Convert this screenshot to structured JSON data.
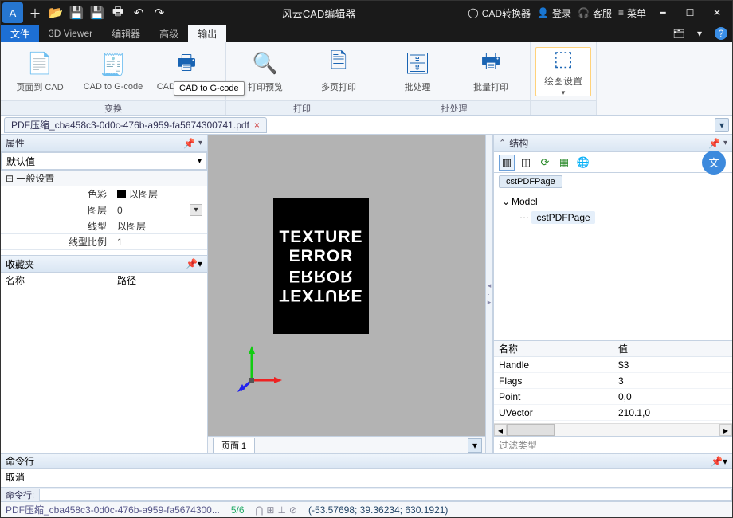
{
  "app": {
    "title": "风云CAD编辑器"
  },
  "titlebar_right": {
    "converter": "CAD转换器",
    "login": "登录",
    "service": "客服",
    "menu": "菜单"
  },
  "menutabs": {
    "file": "文件",
    "viewer": "3D Viewer",
    "editor": "编辑器",
    "advanced": "高级",
    "output": "输出"
  },
  "ribbon": {
    "convert_group": "变换",
    "print_group": "打印",
    "batch_group": "批处理",
    "page_to_cad": "页面到 CAD",
    "cad_to_gcode": "CAD to G-code",
    "cad_to_gcode_sub": "CAD to G-code",
    "print_preview": "打印预览",
    "multi_print": "多页打印",
    "batch": "批处理",
    "batch_print": "批量打印",
    "draw_settings": "绘图设置"
  },
  "tooltip": "CAD to G-code",
  "doctab": "PDF压缩_cba458c3-0d0c-476b-a959-fa5674300741.pdf",
  "panels": {
    "properties": "属性",
    "default": "默认值",
    "general": "一般设置",
    "color": "色彩",
    "color_val": "以图层",
    "layer": "图层",
    "layer_val": "0",
    "linetype": "线型",
    "linetype_val": "以图层",
    "scale": "线型比例",
    "scale_val": "1",
    "favorites": "收藏夹",
    "fav_name": "名称",
    "fav_path": "路径"
  },
  "canvas": {
    "texture": "TEXTURE",
    "error": "ERROR",
    "pagetab": "页面 1"
  },
  "structure": {
    "title": "结构",
    "crumb": "cstPDFPage",
    "model": "Model",
    "leaf": "cstPDFPage",
    "name_col": "名称",
    "value_col": "值",
    "rows": [
      {
        "n": "Handle",
        "v": "$3"
      },
      {
        "n": "Flags",
        "v": "3"
      },
      {
        "n": "Point",
        "v": "0,0"
      },
      {
        "n": "UVector",
        "v": "210.1,0"
      }
    ],
    "filter": "过滤类型"
  },
  "cmd": {
    "title": "命令行",
    "cancel": "取消",
    "prompt": "命令行:"
  },
  "status": {
    "file": "PDF压缩_cba458c3-0d0c-476b-a959-fa5674300...",
    "pages": "5/6",
    "coords": "(-53.57698; 39.36234; 630.1921)"
  }
}
